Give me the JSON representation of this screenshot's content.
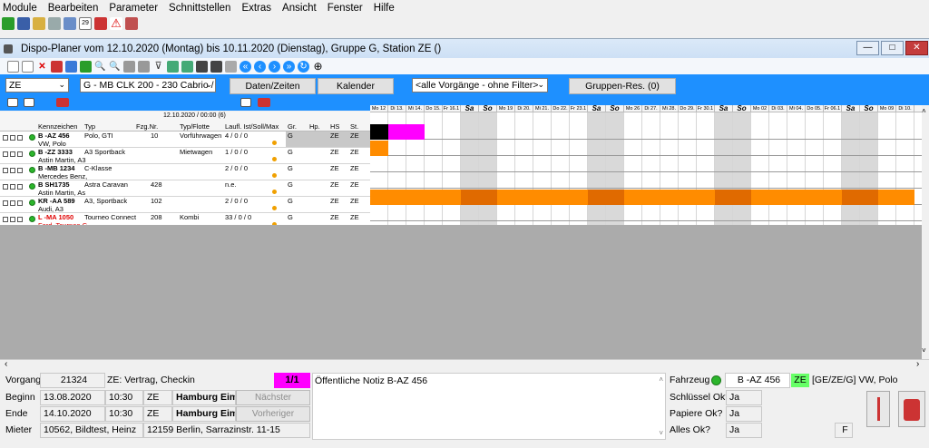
{
  "menu": [
    "Module",
    "Bearbeiten",
    "Parameter",
    "Schnittstellen",
    "Extras",
    "Ansicht",
    "Fenster",
    "Hilfe"
  ],
  "window": {
    "title": "Dispo-Planer vom 12.10.2020 (Montag) bis 10.11.2020 (Dienstag), Gruppe G, Station ZE ()",
    "min": "—",
    "max": "□",
    "close": "✕"
  },
  "filters": {
    "station": "ZE",
    "group": "G - MB CLK 200 - 230 Cabrio / BM",
    "btn_daten": "Daten/Zeiten",
    "btn_kalender": "Kalender",
    "filter": "<alle Vorgänge - ohne Filter>",
    "btn_gruppen": "Gruppen-Res. (0)"
  },
  "header": {
    "timestamp": "12.10.2020 / 00:00 (6)",
    "cols": [
      "Kennzeichen",
      "Typ",
      "Fzg.Nr.",
      "Typ/Flotte",
      "Laufl. Ist/Soll/Max",
      "Gr.",
      "Hp.",
      "HS",
      "St."
    ]
  },
  "rows": [
    {
      "plate": "B -AZ 456",
      "model": "VW, Polo",
      "typ": "Polo, GTI",
      "nr": "10",
      "flotte": "Vorführwagen",
      "laufl": "4 / 0 / 0",
      "gr": "G",
      "hs": "ZE",
      "st": "ZE",
      "plate_color": "#000000"
    },
    {
      "plate": "B -ZZ 3333",
      "model": "Astin Martin, A3",
      "typ": "A3 Sportback",
      "nr": "",
      "flotte": "Mietwagen",
      "laufl": "1 / 0 / 0",
      "gr": "G",
      "hs": "ZE",
      "st": "ZE",
      "plate_color": "#000000"
    },
    {
      "plate": "B -MB 1234",
      "model": "Mercedes Benz,",
      "typ": "C-Klasse",
      "nr": "",
      "flotte": "",
      "laufl": "2 / 0 / 0",
      "gr": "G",
      "hs": "ZE",
      "st": "ZE",
      "plate_color": "#000000"
    },
    {
      "plate": "B SH1735",
      "model": "Astin Martin, As",
      "typ": "Astra Caravan",
      "nr": "428",
      "flotte": "",
      "laufl": "n.e.",
      "gr": "G",
      "hs": "ZE",
      "st": "ZE",
      "plate_color": "#000000"
    },
    {
      "plate": "KR -AA 589",
      "model": "Audi, A3",
      "typ": "A3, Sportback",
      "nr": "102",
      "flotte": "",
      "laufl": "2 / 0 / 0",
      "gr": "G",
      "hs": "ZE",
      "st": "ZE",
      "plate_color": "#000000"
    },
    {
      "plate": "L -MA 1050",
      "model": "Ford, Tourneo C",
      "typ": "Tourneo Connect",
      "nr": "208",
      "flotte": "Kombi",
      "laufl": "33 / 0 / 0",
      "gr": "G",
      "hs": "ZE",
      "st": "ZE",
      "plate_color": "#e00000"
    }
  ],
  "days": [
    "Mo 12",
    "Di 13.",
    "Mi 14.",
    "Do 15.",
    "Fr 16.1",
    "Sa",
    "So",
    "Mo 19",
    "Di 20.",
    "Mi 21.",
    "Do 22.",
    "Fr 23.1",
    "Sa",
    "So",
    "Mo 26",
    "Di 27.",
    "Mi 28.",
    "Do 29.",
    "Fr 30.1",
    "Sa",
    "So",
    "Mo 02",
    "Di 03.",
    "Mi 04.",
    "Do 05.",
    "Fr 06.1",
    "Sa",
    "So",
    "Mo 09",
    "Di 10."
  ],
  "colors": {
    "magenta": "#ff00ff",
    "orange": "#ff8c00",
    "orange_we": "#e06a00",
    "black": "#000000",
    "blue": "#1e90ff",
    "green": "#66ff66"
  },
  "bottom": {
    "vorgang_lbl": "Vorgang",
    "vorgang_nr": "21324",
    "vorgang_text": "ZE: Vertrag, Checkin",
    "counter": "1/1",
    "beginn_lbl": "Beginn",
    "beginn_date": "13.08.2020",
    "beginn_time": "10:30",
    "beginn_st": "ZE",
    "beginn_ort": "Hamburg Eimsl",
    "ende_lbl": "Ende",
    "ende_date": "14.10.2020",
    "ende_time": "10:30",
    "ende_st": "ZE",
    "ende_ort": "Hamburg Eimsl",
    "mieter_lbl": "Mieter",
    "mieter_nr": "10562, Bildtest, Heinz",
    "mieter_addr": "12159  Berlin, Sarrazinstr. 11-15",
    "next_btn": "Nächster Vorgang",
    "prev_btn": "Vorheriger Vorgang",
    "notiz": "Öffentliche Notiz B-AZ 456",
    "fahrzeug_lbl": "Fahrzeug",
    "fahrzeug_plate": "B -AZ 456",
    "fahrzeug_st": "ZE",
    "fahrzeug_info": "[GE/ZE/G] VW, Polo",
    "schluessel_lbl": "Schlüssel Ok?",
    "schluessel_val": "Ja",
    "papiere_lbl": "Papiere Ok?",
    "papiere_val": "Ja",
    "alles_lbl": "Alles Ok?",
    "alles_val": "Ja",
    "f_val": "F"
  }
}
